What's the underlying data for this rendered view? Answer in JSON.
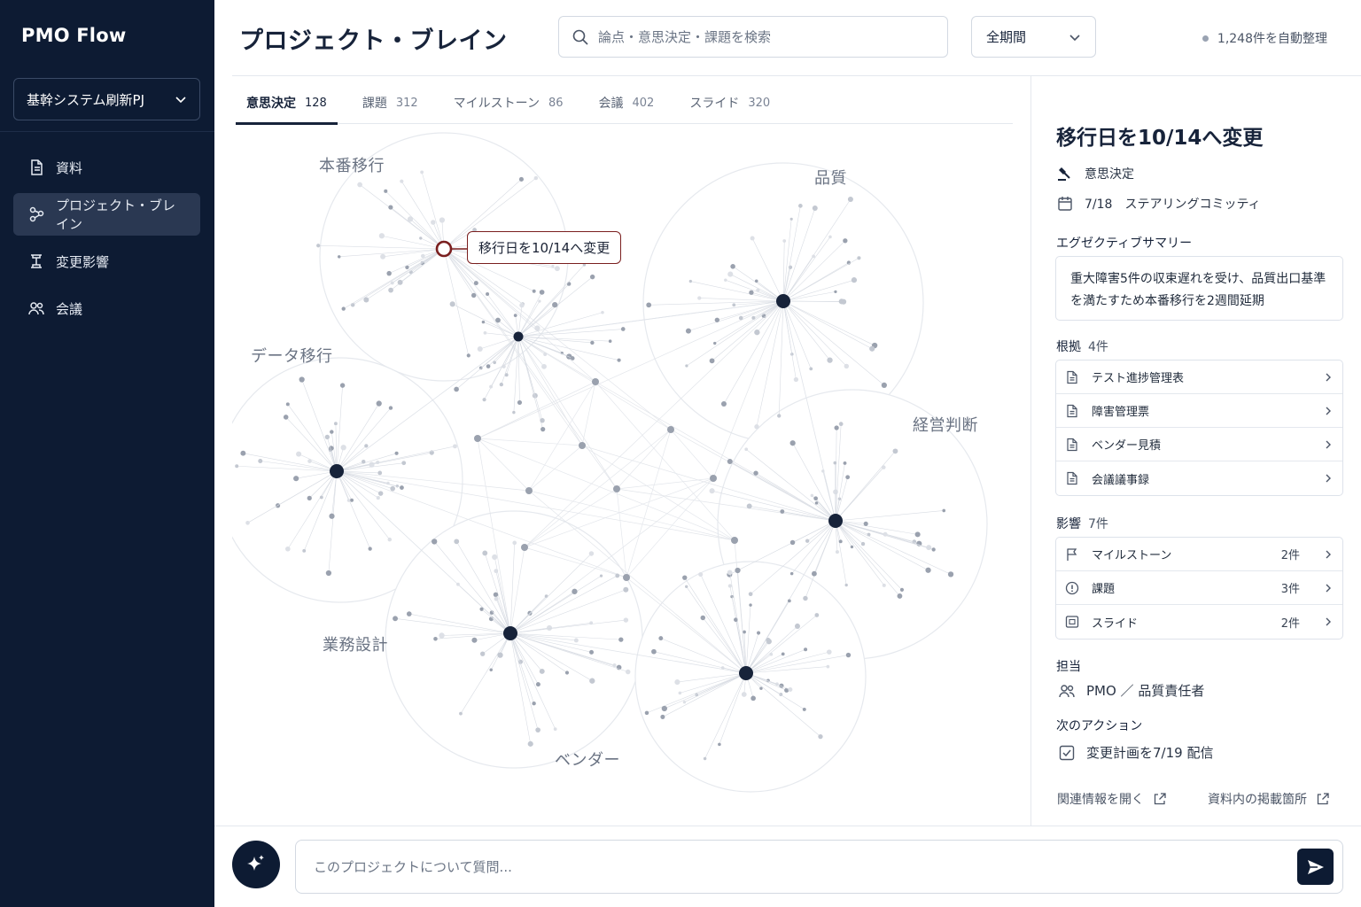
{
  "sidebar": {
    "brand": "PMO Flow",
    "project": "基幹システム刷新PJ",
    "items": [
      {
        "label": "資料",
        "icon": "document-icon",
        "active": false
      },
      {
        "label": "プロジェクト・ブレイン",
        "icon": "network-icon",
        "active": true
      },
      {
        "label": "変更影響",
        "icon": "impact-icon",
        "active": false
      },
      {
        "label": "会議",
        "icon": "people-icon",
        "active": false
      }
    ]
  },
  "header": {
    "title": "プロジェクト・ブレイン",
    "search_placeholder": "論点・意思決定・課題を検索",
    "period": "全期間",
    "auto_status": "1,248件を自動整理"
  },
  "tabs": [
    {
      "label": "意思決定",
      "count": "128",
      "active": true
    },
    {
      "label": "課題",
      "count": "312",
      "active": false
    },
    {
      "label": "マイルストーン",
      "count": "86",
      "active": false
    },
    {
      "label": "会議",
      "count": "402",
      "active": false
    },
    {
      "label": "スライド",
      "count": "320",
      "active": false
    }
  ],
  "graph": {
    "clusters": [
      "本番移行",
      "品質",
      "データ移行",
      "経営判断",
      "業務設計",
      "ベンダー"
    ],
    "callout": "移行日を10/14へ変更",
    "colors": {
      "hub": "#17233a",
      "node": "#9aa1ae",
      "highlight": "#7a1f1f"
    }
  },
  "detail": {
    "title": "移行日を10/14へ変更",
    "type": "意思決定",
    "date_meeting": "7/18　ステアリングコミッティ",
    "summary_label": "エグゼクティブサマリー",
    "summary": "重大障害5件の収束遅れを受け、品質出口基準を満たすため本番移行を2週間延期",
    "evidence_label": "根拠",
    "evidence_count": "4件",
    "evidence": [
      "テスト進捗管理表",
      "障害管理票",
      "ベンダー見積",
      "会議議事録"
    ],
    "impact_label": "影響",
    "impact_count": "7件",
    "impacts": [
      {
        "label": "マイルストーン",
        "count": "2件",
        "icon": "flag-icon"
      },
      {
        "label": "課題",
        "count": "3件",
        "icon": "alert-circle-icon"
      },
      {
        "label": "スライド",
        "count": "2件",
        "icon": "slide-icon"
      }
    ],
    "owner_label": "担当",
    "owner": "PMO ／ 品質責任者",
    "next_label": "次のアクション",
    "next_action": "変更計画を7/19 配信",
    "link_related": "関連情報を開く",
    "link_location": "資料内の掲載箇所"
  },
  "chat": {
    "placeholder": "このプロジェクトについて質問..."
  }
}
